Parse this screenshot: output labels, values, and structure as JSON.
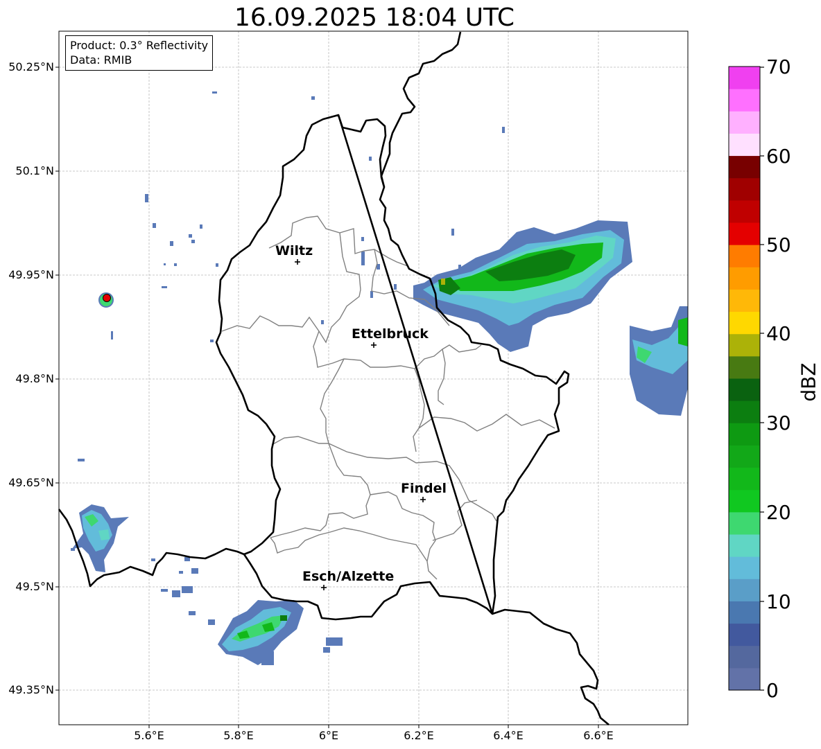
{
  "title": "16.09.2025 18:04 UTC",
  "info": {
    "product": "Product: 0.3° Reflectivity",
    "data": "Data: RMIB"
  },
  "latitude_labels": [
    "50.25°N",
    "50.1°N",
    "49.95°N",
    "49.8°N",
    "49.65°N",
    "49.5°N",
    "49.35°N"
  ],
  "longitude_labels": [
    "5.6°E",
    "5.8°E",
    "6°E",
    "6.2°E",
    "6.4°E",
    "6.6°E"
  ],
  "cities": [
    {
      "name": "Wiltz"
    },
    {
      "name": "Ettelbruck"
    },
    {
      "name": "Findel"
    },
    {
      "name": "Esch/Alzette"
    }
  ],
  "colorbar": {
    "unit": "dBZ",
    "ticks": [
      "0",
      "10",
      "20",
      "30",
      "40",
      "50",
      "60",
      "70"
    ],
    "colors": [
      "#6272a8",
      "#54689e",
      "#42599e",
      "#4a78b0",
      "#5a9ec8",
      "#62bcda",
      "#60d6c4",
      "#3ed870",
      "#10c820",
      "#12b81a",
      "#12a818",
      "#0e9a12",
      "#0c7e10",
      "#0a6210",
      "#487a12",
      "#acb208",
      "#ffd800",
      "#ffb808",
      "#ff9c00",
      "#ff7c00",
      "#e40000",
      "#c00000",
      "#a00000",
      "#780000",
      "#ffe0ff",
      "#ffb0ff",
      "#ff70ff",
      "#f040f0"
    ]
  }
}
